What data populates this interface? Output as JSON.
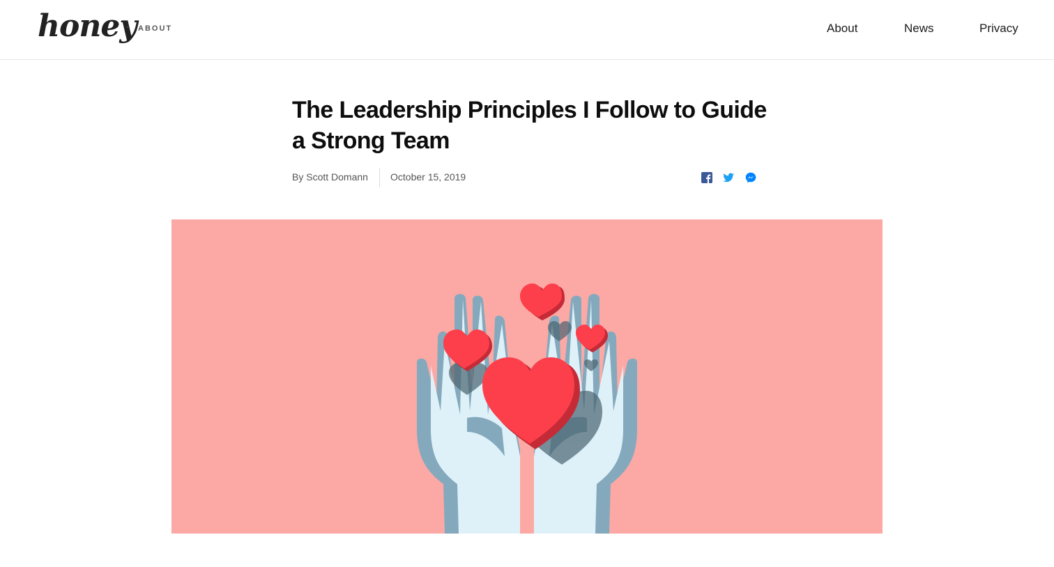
{
  "header": {
    "logo": "honey",
    "separator": "·",
    "section": "ABOUT",
    "nav": [
      {
        "label": "About"
      },
      {
        "label": "News"
      },
      {
        "label": "Privacy"
      }
    ]
  },
  "article": {
    "title": "The Leadership Principles I Follow to Guide a Strong Team",
    "byline": "By Scott Domann",
    "date": "October 15, 2019",
    "share_icons": [
      "facebook-icon",
      "twitter-icon",
      "messenger-icon"
    ]
  },
  "hero": {
    "illustration": "hands-holding-hearts",
    "background_color": "#fca9a5",
    "heart_color": "#fc3f4b",
    "hand_color": "#def1f9"
  },
  "colors": {
    "facebook": "#3b5998",
    "twitter": "#1da1f2",
    "messenger": "#0084ff"
  }
}
